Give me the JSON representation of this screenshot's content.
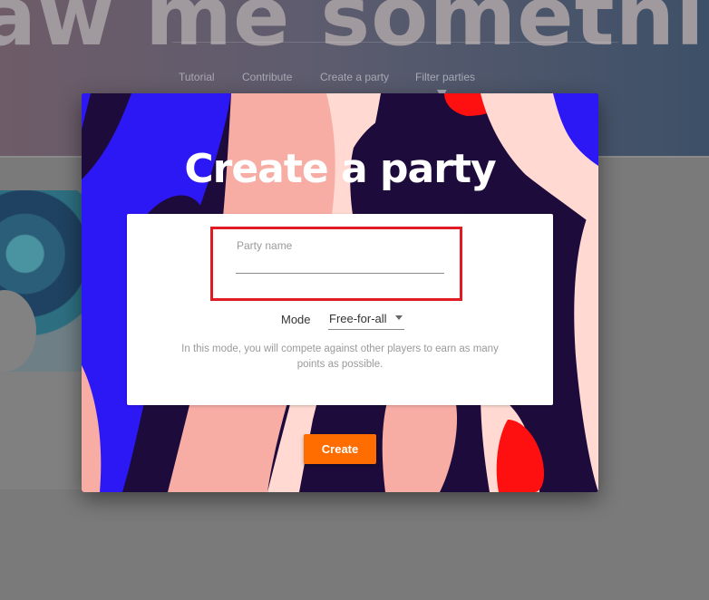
{
  "background": {
    "hero_title": "aw me somethin",
    "nav": [
      {
        "label": "Tutorial",
        "icon": "graduation-cap-icon"
      },
      {
        "label": "Contribute",
        "icon": "brush-icon"
      },
      {
        "label": "Create a party",
        "icon": "group-icon"
      },
      {
        "label": "Filter parties",
        "icon": "filter-icon"
      }
    ]
  },
  "modal": {
    "title": "Create a party",
    "party_name": {
      "label": "Party name",
      "value": ""
    },
    "mode": {
      "label": "Mode",
      "selected": "Free-for-all"
    },
    "mode_description": "In this mode, you will compete against other players to earn as many points as possible.",
    "create_label": "Create"
  },
  "colors": {
    "accent": "#ff6d00",
    "highlight_box": "#e01b24",
    "art_blue": "#2c17f5",
    "art_pink": "#f7aca4",
    "art_light_pink": "#ffd9d2",
    "art_dark": "#1c0b3b",
    "art_red": "#ff1010"
  }
}
